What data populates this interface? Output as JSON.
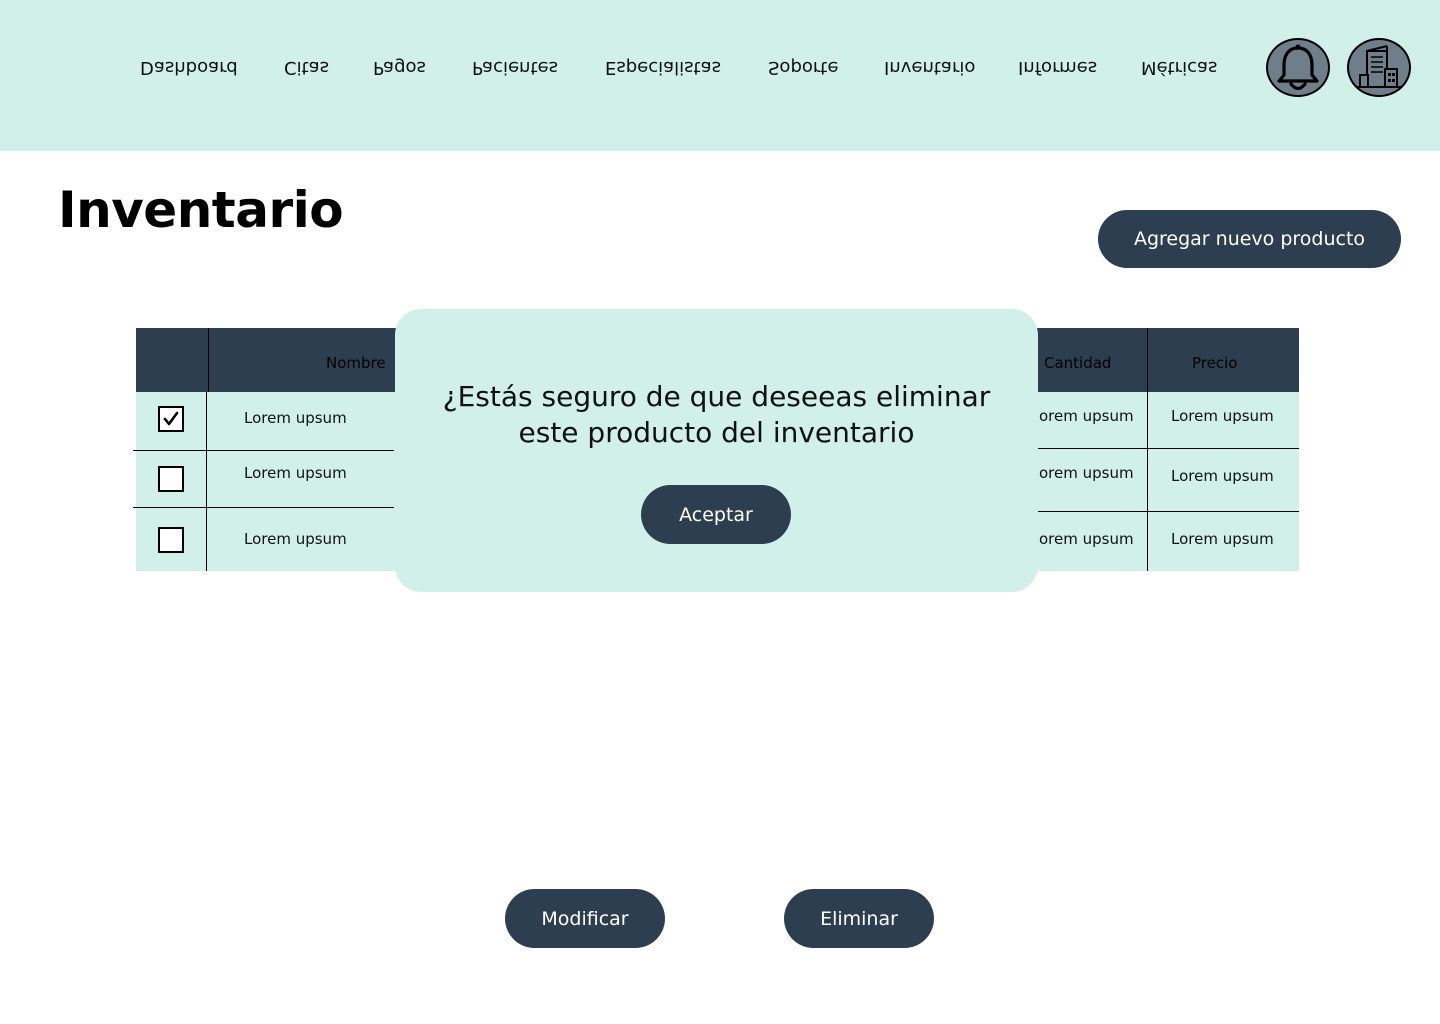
{
  "nav": {
    "items": [
      "Dashboard",
      "Citas",
      "Pagos",
      "Pacientes",
      "Especialistas",
      "Soporte",
      "Inventario",
      "Informes",
      "Métricas"
    ]
  },
  "icons": {
    "notifications": "bell-icon",
    "organization": "building-icon"
  },
  "page": {
    "title": "Inventario",
    "add_button": "Agregar nuevo producto"
  },
  "table": {
    "headers": {
      "name": "Nombre",
      "quantity": "Cantidad",
      "price": "Precio"
    },
    "rows": [
      {
        "checked": true,
        "name": "Lorem upsum",
        "quantity": "orem upsum",
        "price": "Lorem upsum"
      },
      {
        "checked": false,
        "name": "Lorem upsum",
        "quantity": "orem upsum",
        "price": "Lorem upsum"
      },
      {
        "checked": false,
        "name": "Lorem upsum",
        "quantity": "orem upsum",
        "price": "Lorem upsum"
      }
    ]
  },
  "modal": {
    "line1": "¿Estás seguro de que  deseeas eliminar",
    "line2": "este producto del inventario",
    "accept": "Aceptar"
  },
  "actions": {
    "modify": "Modificar",
    "delete": "Eliminar"
  },
  "colors": {
    "header_bg": "#d1f0e9",
    "primary": "#2e3e51",
    "button_text": "#ffffff"
  }
}
